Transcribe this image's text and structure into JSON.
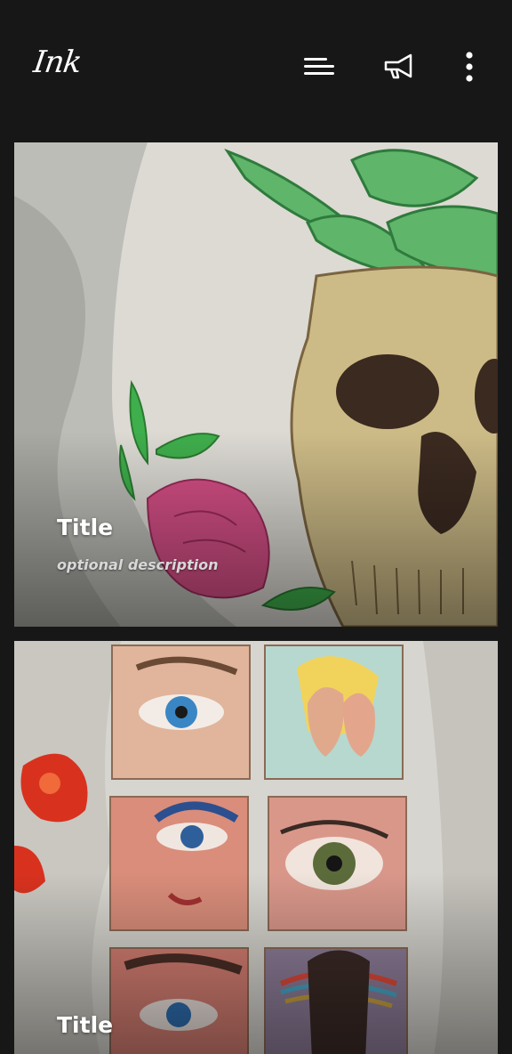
{
  "app": {
    "logo_text": "Ink"
  },
  "toolbar": {
    "menu_icon": "menu-icon",
    "announce_icon": "megaphone-icon",
    "more_icon": "more-vertical-icon"
  },
  "cards": [
    {
      "title": "Title",
      "description": "optional description"
    },
    {
      "title": "Title"
    }
  ],
  "colors": {
    "background": "#171717",
    "text": "#ffffff",
    "description": "#d8d8d8"
  }
}
